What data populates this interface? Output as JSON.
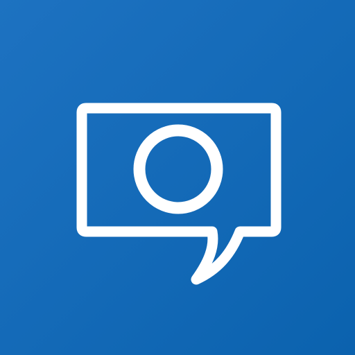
{
  "app_tile": {
    "icon": "speech-bubble-letter-o-icon",
    "colors": {
      "background_top_left": "#1D72C1",
      "background_bottom_right": "#0B62AE",
      "glyph": "#FFFFFF"
    }
  }
}
